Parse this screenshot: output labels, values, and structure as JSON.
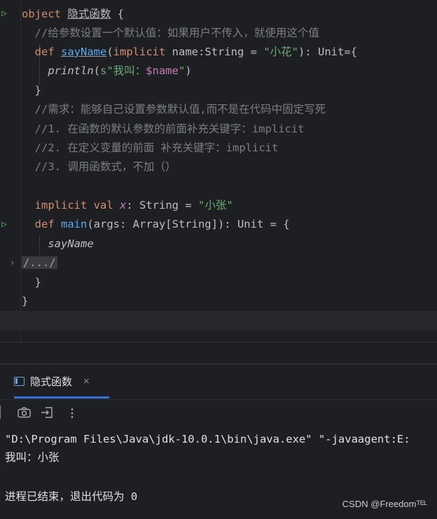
{
  "editor": {
    "lines": [
      {
        "segments": [
          [
            "kw",
            "object "
          ],
          [
            "ul",
            "隐式函数"
          ],
          [
            "tp",
            " {"
          ]
        ]
      },
      {
        "segments": [
          [
            "cm",
            "  //给参数设置一个默认值：如果用户不传入，就使用这个值"
          ]
        ]
      },
      {
        "segments": [
          [
            "kw",
            "  def "
          ],
          [
            "fn ul",
            "sayName"
          ],
          [
            "tp",
            "("
          ],
          [
            "kw",
            "implicit "
          ],
          [
            "tp",
            "name:String = "
          ],
          [
            "str",
            "\"小花\""
          ],
          [
            "tp",
            "): Unit={"
          ]
        ]
      },
      {
        "segments": [
          [
            "tp",
            "    "
          ],
          [
            "it",
            "println"
          ],
          [
            "tp",
            "("
          ],
          [
            "str",
            "s\"我叫："
          ],
          [
            "iv",
            "$name"
          ],
          [
            "str",
            "\""
          ],
          [
            "tp",
            ")"
          ]
        ]
      },
      {
        "segments": [
          [
            "tp",
            "  }"
          ]
        ]
      },
      {
        "segments": [
          [
            "cm",
            "  //需求：能够自己设置参数默认值,而不是在代码中固定写死"
          ]
        ]
      },
      {
        "segments": [
          [
            "cm",
            "  //1. 在函数的默认参数的前面补充关键字：implicit"
          ]
        ]
      },
      {
        "segments": [
          [
            "cm",
            "  //2. 在定义变量的前面 补充关键字：implicit"
          ]
        ]
      },
      {
        "segments": [
          [
            "cm",
            "  //3. 调用函数式，不加（）"
          ]
        ]
      },
      {
        "segments": [
          [
            "tp",
            ""
          ]
        ]
      },
      {
        "segments": [
          [
            "kw",
            "  implicit val "
          ],
          [
            "iv it",
            "x"
          ],
          [
            "tp",
            ": String = "
          ],
          [
            "str",
            "\"小张\""
          ]
        ]
      },
      {
        "segments": [
          [
            "kw",
            "  def "
          ],
          [
            "fn",
            "main"
          ],
          [
            "tp",
            "(args: Array[String]): Unit = {"
          ]
        ]
      },
      {
        "segments": [
          [
            "tp",
            "    "
          ],
          [
            "it",
            "sayName"
          ]
        ]
      },
      {
        "segments": [
          [
            "fold",
            "/.../"
          ]
        ]
      },
      {
        "segments": [
          [
            "tp",
            "  }"
          ]
        ]
      },
      {
        "segments": [
          [
            "tp",
            "}"
          ]
        ]
      }
    ]
  },
  "run_panel": {
    "tab_label": "隐式函数",
    "close_icon": "×",
    "toolbar_icons": [
      "camera-icon",
      "exit-icon",
      "more-icon"
    ],
    "console_lines": [
      "\"D:\\Program Files\\Java\\jdk-10.0.1\\bin\\java.exe\" \"-javaagent:E:",
      "我叫：小张",
      "",
      "进程已结束，退出代码为 0"
    ]
  },
  "watermark": "CSDN @Freedomᵀᴱᴸ",
  "colors": {
    "background": "#1e1f22",
    "keyword": "#cf8e6d",
    "comment": "#7a7e85",
    "function": "#56a8f5",
    "string": "#6aab73",
    "interpolation": "#c77dbb",
    "text": "#bcbec4",
    "accent": "#3574f0"
  }
}
